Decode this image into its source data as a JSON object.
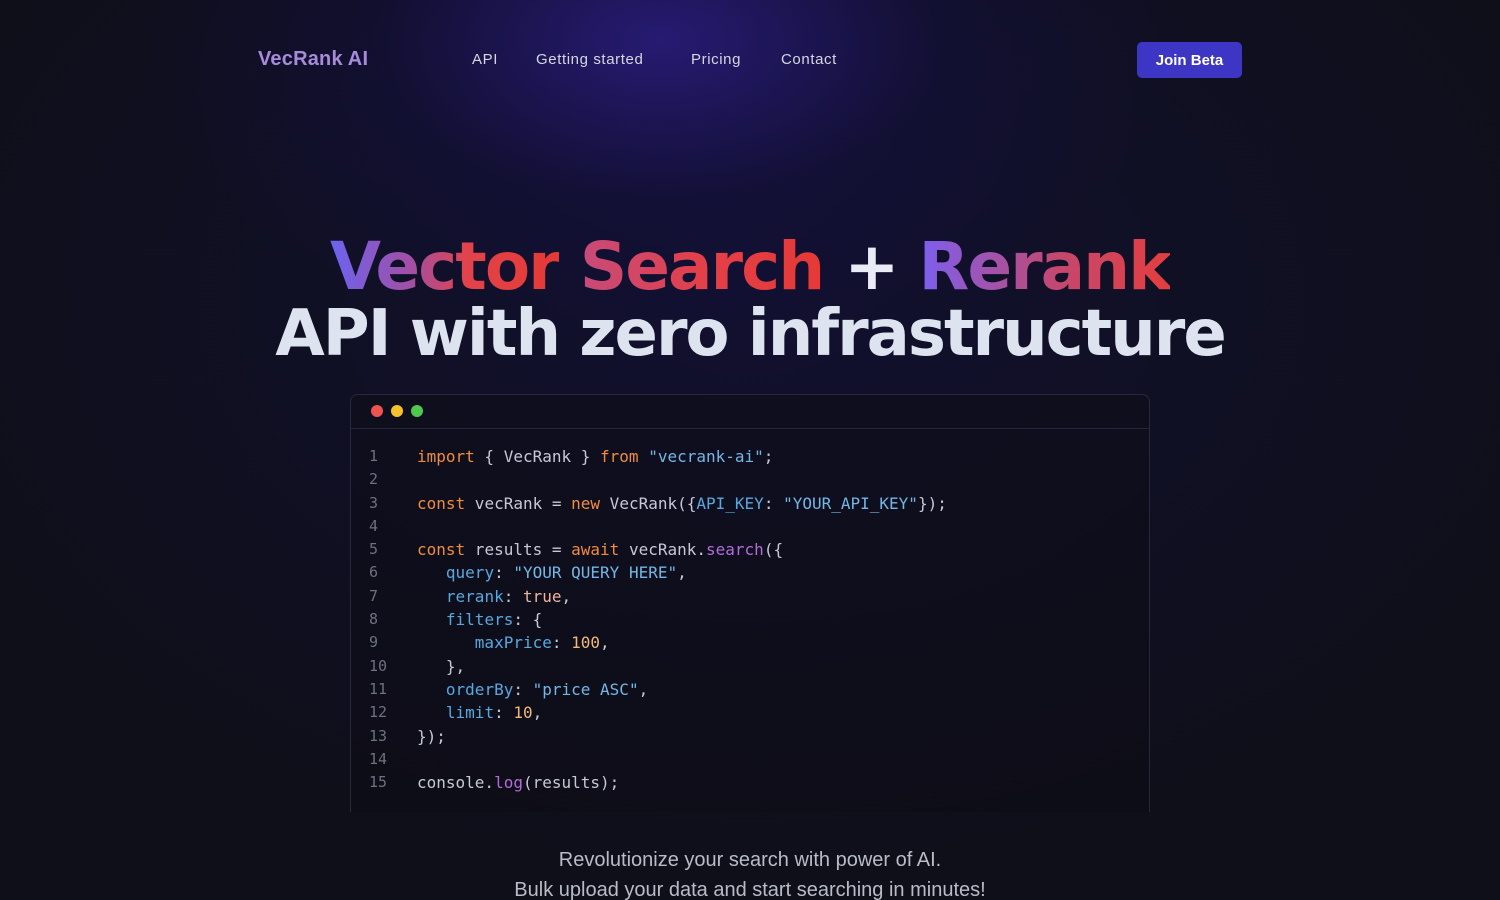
{
  "brand": {
    "name": "VecRank AI"
  },
  "nav": {
    "links": [
      "API",
      "Getting started",
      "Pricing",
      "Contact"
    ],
    "cta": "Join Beta"
  },
  "hero": {
    "word1": "Vector",
    "word2": "Search",
    "plus": "+",
    "word3": "Rerank",
    "line2": "API with zero infrastructure"
  },
  "code": {
    "line_numbers": [
      "1",
      "2",
      "3",
      "4",
      "5",
      "6",
      "7",
      "8",
      "9",
      "10",
      "11",
      "12",
      "13",
      "14",
      "15"
    ],
    "lines": [
      [
        [
          "kw",
          "import"
        ],
        [
          "p",
          " { VecRank } "
        ],
        [
          "kw",
          "from"
        ],
        [
          "p",
          " "
        ],
        [
          "str",
          "\"vecrank-ai\""
        ],
        [
          "p",
          ";"
        ]
      ],
      [],
      [
        [
          "kw",
          "const"
        ],
        [
          "p",
          " vecRank = "
        ],
        [
          "kw",
          "new"
        ],
        [
          "p",
          " VecRank({"
        ],
        [
          "prop",
          "API_KEY"
        ],
        [
          "p",
          ": "
        ],
        [
          "str",
          "\"YOUR_API_KEY\""
        ],
        [
          "p",
          "});"
        ]
      ],
      [],
      [
        [
          "kw",
          "const"
        ],
        [
          "p",
          " results = "
        ],
        [
          "kw",
          "await"
        ],
        [
          "p",
          " vecRank."
        ],
        [
          "fn",
          "search"
        ],
        [
          "p",
          "({"
        ]
      ],
      [
        [
          "p",
          "   "
        ],
        [
          "prop",
          "query"
        ],
        [
          "p",
          ": "
        ],
        [
          "str",
          "\"YOUR QUERY HERE\""
        ],
        [
          "p",
          ","
        ]
      ],
      [
        [
          "p",
          "   "
        ],
        [
          "prop",
          "rerank"
        ],
        [
          "p",
          ": "
        ],
        [
          "bool",
          "true"
        ],
        [
          "p",
          ","
        ]
      ],
      [
        [
          "p",
          "   "
        ],
        [
          "prop",
          "filters"
        ],
        [
          "p",
          ": {"
        ]
      ],
      [
        [
          "p",
          "      "
        ],
        [
          "prop",
          "maxPrice"
        ],
        [
          "p",
          ": "
        ],
        [
          "num",
          "100"
        ],
        [
          "p",
          ","
        ]
      ],
      [
        [
          "p",
          "   },"
        ]
      ],
      [
        [
          "p",
          "   "
        ],
        [
          "prop",
          "orderBy"
        ],
        [
          "p",
          ": "
        ],
        [
          "str",
          "\"price ASC\""
        ],
        [
          "p",
          ","
        ]
      ],
      [
        [
          "p",
          "   "
        ],
        [
          "prop",
          "limit"
        ],
        [
          "p",
          ": "
        ],
        [
          "num",
          "10"
        ],
        [
          "p",
          ","
        ]
      ],
      [
        [
          "p",
          "});"
        ]
      ],
      [],
      [
        [
          "p",
          "console."
        ],
        [
          "fn",
          "log"
        ],
        [
          "p",
          "(results);"
        ]
      ]
    ]
  },
  "tagline": {
    "line1": "Revolutionize your search with power of AI.",
    "line2": "Bulk upload your data and start searching in minutes!"
  }
}
